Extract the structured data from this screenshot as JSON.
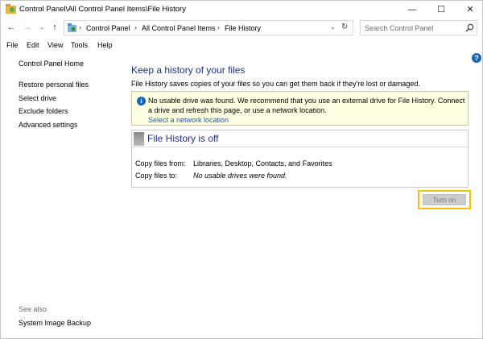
{
  "window": {
    "title": "Control Panel\\All Control Panel Items\\File History",
    "controls": {
      "minimize": "—",
      "maximize": "☐",
      "close": "✕"
    }
  },
  "nav": {
    "back": "←",
    "forward": "→",
    "history": "⌄",
    "up": "↑",
    "breadcrumbs": [
      "Control Panel",
      "All Control Panel Items",
      "File History"
    ],
    "separator": "›",
    "address_dropdown": "⌄",
    "refresh": "↻"
  },
  "search": {
    "placeholder": "Search Control Panel"
  },
  "menu": [
    "File",
    "Edit",
    "View",
    "Tools",
    "Help"
  ],
  "sidebar": {
    "home": "Control Panel Home",
    "links": [
      "Restore personal files",
      "Select drive",
      "Exclude folders",
      "Advanced settings"
    ],
    "see_also_label": "See also",
    "see_also_links": [
      "System Image Backup"
    ]
  },
  "help": "?",
  "main": {
    "title": "Keep a history of your files",
    "description": "File History saves copies of your files so you can get them back if they're lost or damaged.",
    "warning": {
      "icon_glyph": "i",
      "text": "No usable drive was found. We recommend that you use an external drive for File History. Connect a drive and refresh this page, or use a network location.",
      "link": "Select a network location"
    },
    "status": {
      "title": "File History is off",
      "rows": [
        {
          "label": "Copy files from:",
          "value": "Libraries, Desktop, Contacts, and Favorites"
        },
        {
          "label": "Copy files to:",
          "value": "No usable drives were found."
        }
      ]
    },
    "turn_on_label": "Turn on"
  },
  "colors": {
    "title_blue": "#1e3287",
    "link_blue": "#1a5cb8",
    "warning_bg": "#ffffe1",
    "highlight": "#f5c000"
  }
}
